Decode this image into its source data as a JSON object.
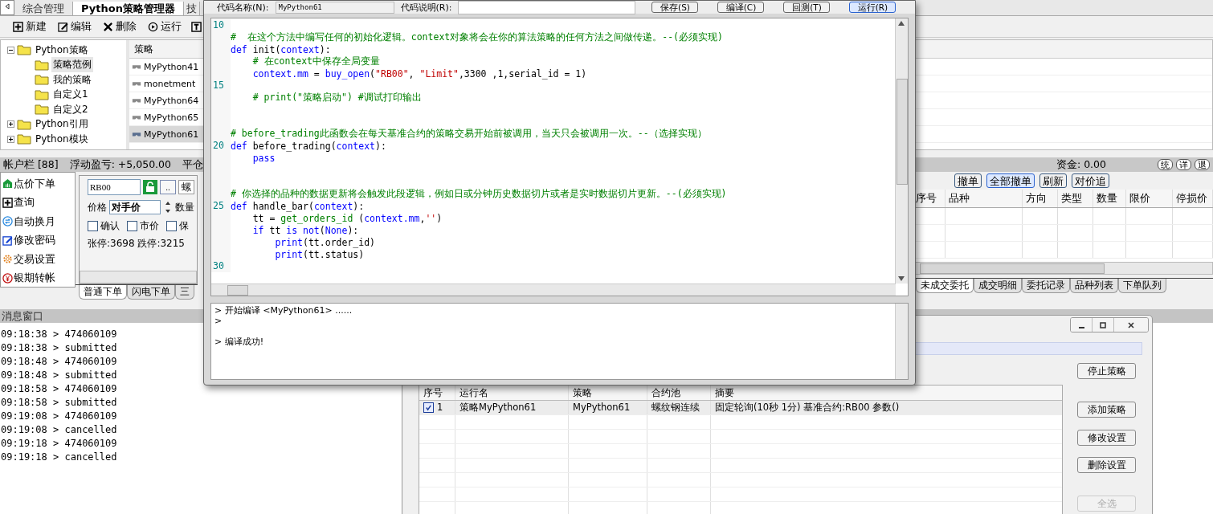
{
  "main_tabs": [
    {
      "label": "综合管理",
      "selected": false
    },
    {
      "label": "Python策略管理器",
      "selected": true
    },
    {
      "label": "技",
      "selected": false
    }
  ],
  "toolbar": [
    "新建",
    "编辑",
    "删除",
    "运行"
  ],
  "tree": [
    {
      "label": "Python策略",
      "expanded": true,
      "selected": false,
      "children": [
        {
          "label": "策略范例",
          "selected": true
        },
        {
          "label": "我的策略",
          "selected": false
        },
        {
          "label": "自定义1",
          "selected": false
        },
        {
          "label": "自定义2",
          "selected": false
        }
      ]
    },
    {
      "label": "Python引用",
      "expanded": false,
      "selected": false
    },
    {
      "label": "Python模块",
      "expanded": false,
      "selected": false
    }
  ],
  "strategy_list": {
    "header": "策略",
    "items": [
      {
        "label": "MyPython41",
        "selected": false
      },
      {
        "label": "monetment",
        "selected": false
      },
      {
        "label": "MyPython64",
        "selected": false
      },
      {
        "label": "MyPython65",
        "selected": false
      },
      {
        "label": "MyPython61",
        "selected": true
      }
    ]
  },
  "account_bar": {
    "title": "帐户栏 [88]",
    "floating_pnl": "浮动盈亏: +5,050.00",
    "closed_pnl": "平仓",
    "funds": "资金: 0.00",
    "buttons": [
      "统",
      "详",
      "退"
    ]
  },
  "nav": [
    "点价下单",
    "查询",
    "自动换月",
    "修改密码",
    "交易设置",
    "银期转帐"
  ],
  "order_form": {
    "symbol": "RB00",
    "browse": "..",
    "contract": "螺",
    "price_label": "价格",
    "price_type": "对手价",
    "qty_label": "数量",
    "options": [
      {
        "label": "确认",
        "checked": false
      },
      {
        "label": "市价",
        "checked": false
      },
      {
        "label": "保",
        "checked": false
      }
    ],
    "limits": "张停:3698 跌停:3215"
  },
  "order_tabs": [
    {
      "label": "普通下单",
      "selected": true
    },
    {
      "label": "闪电下单",
      "selected": false
    },
    {
      "label": "三",
      "selected": false
    }
  ],
  "orders": {
    "buttons": [
      {
        "label": "撤单",
        "default": false
      },
      {
        "label": "全部撤单",
        "default": true
      },
      {
        "label": "刷新",
        "default": false
      },
      {
        "label": "对价追",
        "default": false
      }
    ],
    "columns": [
      "序号",
      "品种",
      "方向",
      "类型",
      "数量",
      "限价",
      "停损价"
    ],
    "tabs": [
      {
        "label": "未成交委托",
        "selected": true
      },
      {
        "label": "成交明细",
        "selected": false
      },
      {
        "label": "委托记录",
        "selected": false
      },
      {
        "label": "品种列表",
        "selected": false
      },
      {
        "label": "下单队列",
        "selected": false
      }
    ]
  },
  "messages": {
    "title": "消息窗口",
    "lines": [
      "09:18:38 > 474060109",
      "09:18:38 > submitted",
      "09:18:48 > 474060109",
      "09:18:48 > submitted",
      "09:18:58 > 474060109",
      "09:18:58 > submitted",
      "09:19:08 > 474060109",
      "09:19:08 > cancelled",
      "09:19:18 > 474060109",
      "09:19:18 > cancelled"
    ]
  },
  "code_dialog": {
    "name_label": "代码名称(N):",
    "name_value": "MyPython61",
    "desc_label": "代码说明(R):",
    "buttons": [
      {
        "label": "保存(S)",
        "default": false
      },
      {
        "label": "编译(C)",
        "default": false
      },
      {
        "label": "回测(T)",
        "default": false
      },
      {
        "label": "运行(R)",
        "default": true
      }
    ],
    "lines": [
      {
        "kind": "blank",
        "number": "10"
      },
      {
        "kind": "code",
        "tokens": [
          {
            "kind": "comment",
            "text": "#  在这个方法中编写任何的初始化逻辑。context对象将会在你的算法策略的任何方法之间做传递。--(必须实现)"
          }
        ]
      },
      {
        "kind": "code",
        "tokens": [
          {
            "kind": "keyword",
            "text": "def"
          },
          {
            "kind": "plain",
            "text": " init("
          },
          {
            "kind": "keyword",
            "text": "context"
          },
          {
            "kind": "plain",
            "text": "):"
          }
        ]
      },
      {
        "kind": "code",
        "tokens": [
          {
            "kind": "comment",
            "text": "    # 在context中保存全局变量"
          }
        ]
      },
      {
        "kind": "code",
        "tokens": [
          {
            "kind": "keyword",
            "text": "    context.mm"
          },
          {
            "kind": "plain",
            "text": " = "
          },
          {
            "kind": "keyword",
            "text": "buy_open"
          },
          {
            "kind": "plain",
            "text": "("
          },
          {
            "kind": "string",
            "text": "\"RB00\""
          },
          {
            "kind": "plain",
            "text": ", "
          },
          {
            "kind": "string",
            "text": "\"Limit\""
          },
          {
            "kind": "plain",
            "text": ",3300 ,1,serial_id = 1)"
          }
        ]
      },
      {
        "kind": "blank",
        "number": "15"
      },
      {
        "kind": "code",
        "tokens": [
          {
            "kind": "comment",
            "text": "    # print(\"策略启动\") #调试打印输出"
          }
        ]
      },
      {
        "kind": "blank"
      },
      {
        "kind": "blank"
      },
      {
        "kind": "code",
        "tokens": [
          {
            "kind": "comment",
            "text": "# before_trading此函数会在每天基准合约的策略交易开始前被调用，当天只会被调用一次。--（选择实现）"
          }
        ]
      },
      {
        "kind": "code",
        "number": "20",
        "tokens": [
          {
            "kind": "keyword",
            "text": "def"
          },
          {
            "kind": "plain",
            "text": " before_trading("
          },
          {
            "kind": "keyword",
            "text": "context"
          },
          {
            "kind": "plain",
            "text": "):"
          }
        ]
      },
      {
        "kind": "code",
        "tokens": [
          {
            "kind": "keyword",
            "text": "    pass"
          }
        ]
      },
      {
        "kind": "blank"
      },
      {
        "kind": "blank"
      },
      {
        "kind": "code",
        "tokens": [
          {
            "kind": "comment",
            "text": "# 你选择的品种的数据更新将会触发此段逻辑，例如日或分钟历史数据切片或者是实时数据切片更新。--(必须实现)"
          }
        ]
      },
      {
        "kind": "code",
        "number": "25",
        "tokens": [
          {
            "kind": "keyword",
            "text": "def"
          },
          {
            "kind": "plain",
            "text": " handle_bar("
          },
          {
            "kind": "keyword",
            "text": "context"
          },
          {
            "kind": "plain",
            "text": "):"
          }
        ]
      },
      {
        "kind": "code",
        "tokens": [
          {
            "kind": "plain",
            "text": "    tt = "
          },
          {
            "kind": "func",
            "text": "get_orders_id"
          },
          {
            "kind": "plain",
            "text": " ("
          },
          {
            "kind": "keyword",
            "text": "context.mm"
          },
          {
            "kind": "plain",
            "text": ","
          },
          {
            "kind": "string",
            "text": "''"
          },
          {
            "kind": "plain",
            "text": ")"
          }
        ]
      },
      {
        "kind": "code",
        "tokens": [
          {
            "kind": "keyword",
            "text": "    if"
          },
          {
            "kind": "plain",
            "text": " tt "
          },
          {
            "kind": "keyword",
            "text": "is not"
          },
          {
            "kind": "plain",
            "text": "("
          },
          {
            "kind": "keyword",
            "text": "None"
          },
          {
            "kind": "plain",
            "text": "):"
          }
        ]
      },
      {
        "kind": "code",
        "tokens": [
          {
            "kind": "keyword",
            "text": "        print"
          },
          {
            "kind": "plain",
            "text": "(tt.order_id)"
          }
        ]
      },
      {
        "kind": "code",
        "tokens": [
          {
            "kind": "keyword",
            "text": "        print"
          },
          {
            "kind": "plain",
            "text": "(tt.status)"
          }
        ]
      },
      {
        "kind": "blank",
        "number": "30"
      }
    ],
    "output": [
      "> 开始编译 <MyPython61> ......",
      ">",
      "> 编译成功!"
    ]
  },
  "run_dialog": {
    "columns": [
      "序号",
      "运行名",
      "策略",
      "合约池",
      "摘要"
    ],
    "rows": [
      {
        "checked": true,
        "cells": [
          "1",
          "策略MyPython61",
          "MyPython61",
          "螺纹钢连续",
          "固定轮询(10秒 1分) 基准合约:RB00 参数()"
        ]
      }
    ],
    "buttons": [
      {
        "label": "停止策略",
        "disabled": false
      },
      {
        "label": "添加策略",
        "disabled": false
      },
      {
        "label": "修改设置",
        "disabled": false
      },
      {
        "label": "删除设置",
        "disabled": false
      },
      {
        "label": "全选",
        "disabled": true
      }
    ]
  }
}
